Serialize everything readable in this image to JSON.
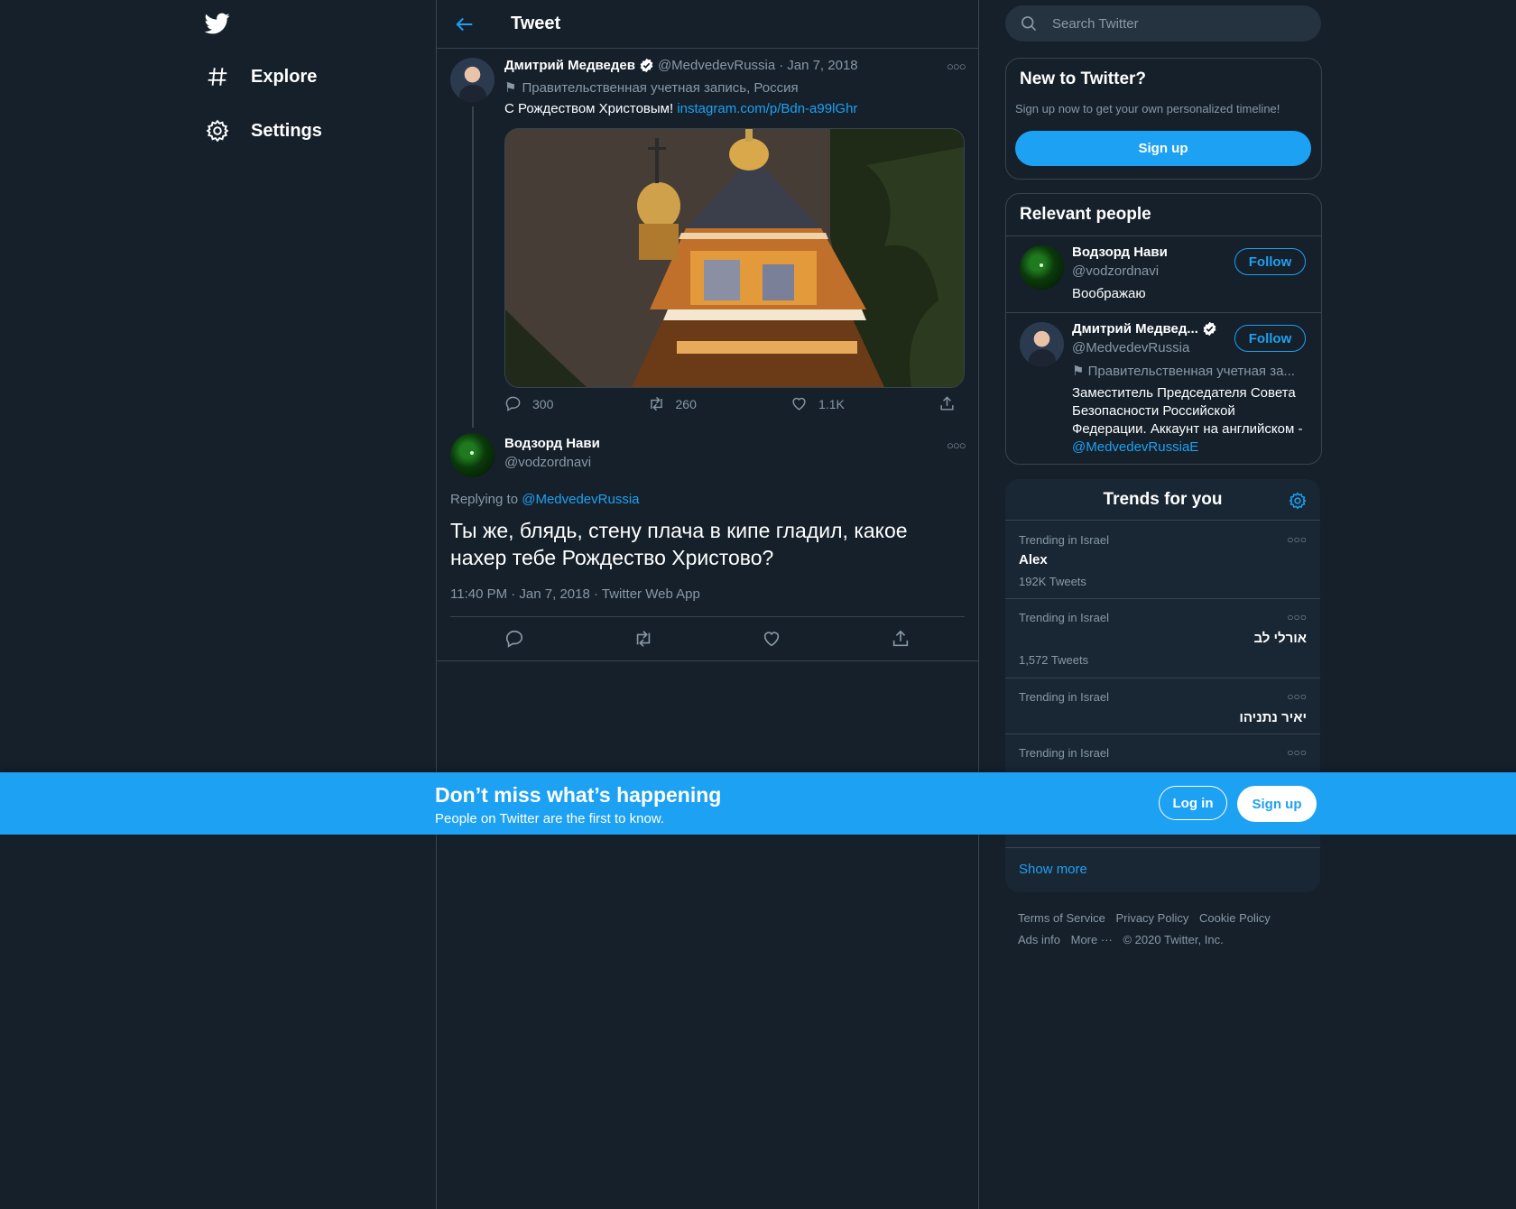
{
  "colors": {
    "background": "#15202b",
    "accent": "#1da1f2",
    "muted": "#8899a6",
    "border": "#38444d",
    "panel": "#192734"
  },
  "nav": {
    "logo_icon": "twitter-bird-icon",
    "items": [
      {
        "label": "Explore",
        "icon": "hashtag-icon"
      },
      {
        "label": "Settings",
        "icon": "gear-icon"
      }
    ]
  },
  "header": {
    "title": "Tweet",
    "back_icon": "arrow-left-icon"
  },
  "tweet": {
    "name": "Дмитрий Медведев",
    "handle": "@MedvedevRussia",
    "date": "Jan 7, 2018",
    "label": "Правительственная учетная запись, Россия",
    "text": "С Рождеством Христовым!",
    "link": "instagram.com/p/Bdn-a99lGhr",
    "stats": {
      "replies": "300",
      "retweets": "260",
      "likes": "1.1K"
    }
  },
  "reply": {
    "name": "Водзорд Нави",
    "handle": "@vodzordnavi",
    "replying_prefix": "Replying to",
    "replying_to": "@MedvedevRussia",
    "text": "Ты же, блядь, стену плача в кипе гладил, какое нахер тебе Рождество Христово?",
    "meta": "11:40 PM · Jan 7, 2018 · Twitter Web App"
  },
  "search": {
    "placeholder": "Search Twitter"
  },
  "signup_card": {
    "title": "New to Twitter?",
    "subtitle": "Sign up now to get your own personalized timeline!",
    "button": "Sign up"
  },
  "relevant_people": {
    "title": "Relevant people",
    "people": [
      {
        "name": "Водзорд Нави",
        "handle": "@vodzordnavi",
        "bio": "Воображаю",
        "button": "Follow"
      },
      {
        "name": "Дмитрий Медвед...",
        "handle": "@MedvedevRussia",
        "label": "Правительственная учетная за...",
        "bio": "Заместитель Председателя Совета Безопасности Российской Федерации. Аккаунт на английском - ",
        "bio_link": "@MedvedevRussiaE",
        "button": "Follow"
      }
    ]
  },
  "trends": {
    "title": "Trends for you",
    "items": [
      {
        "context": "Trending in Israel",
        "name": "Alex",
        "count": "192K Tweets"
      },
      {
        "context": "Trending in Israel",
        "name": "אורלי לב",
        "count": "1,572 Tweets"
      },
      {
        "context": "Trending in Israel",
        "name": "יאיר נתניהו",
        "count": ""
      },
      {
        "context": "Trending in Israel",
        "name": "",
        "count": ""
      }
    ],
    "show_more": "Show more"
  },
  "footer": {
    "links": [
      "Terms of Service",
      "Privacy Policy",
      "Cookie Policy",
      "Ads info",
      "More ···"
    ],
    "copyright": "© 2020 Twitter, Inc."
  },
  "banner": {
    "title": "Don’t miss what’s happening",
    "subtitle": "People on Twitter are the first to know.",
    "login": "Log in",
    "signup": "Sign up"
  }
}
